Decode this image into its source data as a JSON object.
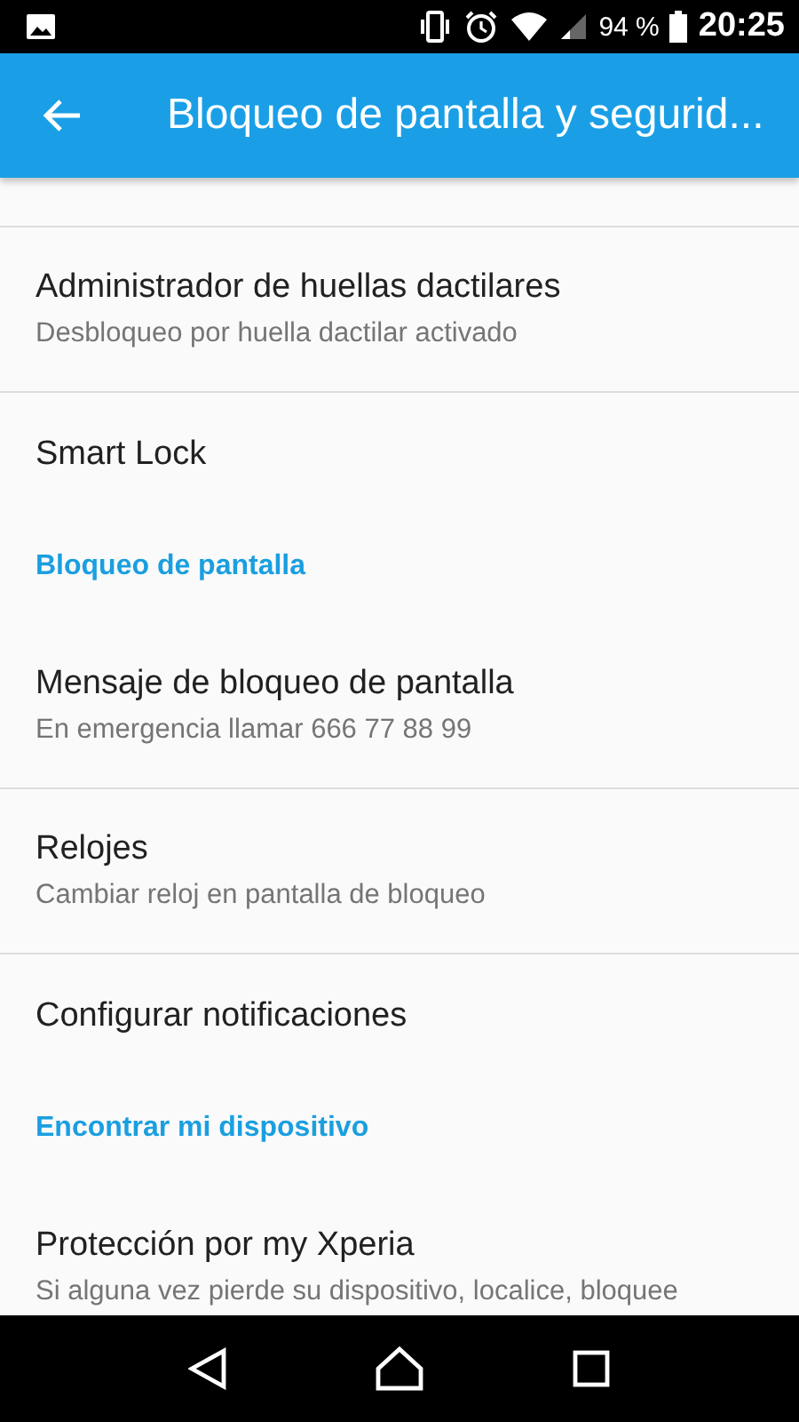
{
  "status_bar": {
    "battery_text": "94 %",
    "time": "20:25"
  },
  "app_bar": {
    "title": "Bloqueo de pantalla y segurid..."
  },
  "list": [
    {
      "kind": "item",
      "title": "Administrador de huellas dactilares",
      "summary": "Desbloqueo por huella dactilar activado",
      "divider": true
    },
    {
      "kind": "item",
      "title": "Smart Lock",
      "divider": false
    },
    {
      "kind": "header",
      "title": "Bloqueo de pantalla"
    },
    {
      "kind": "item",
      "title": "Mensaje de bloqueo de pantalla",
      "summary": "En emergencia llamar 666 77 88 99",
      "divider": true
    },
    {
      "kind": "item",
      "title": "Relojes",
      "summary": "Cambiar reloj en pantalla de bloqueo",
      "divider": true
    },
    {
      "kind": "item",
      "title": "Configurar notificaciones",
      "divider": false
    },
    {
      "kind": "header",
      "title": "Encontrar mi dispositivo"
    },
    {
      "kind": "item",
      "title": "Protección por my Xperia",
      "summary": "Si alguna vez pierde su dispositivo, localice, bloquee",
      "divider": false
    }
  ]
}
